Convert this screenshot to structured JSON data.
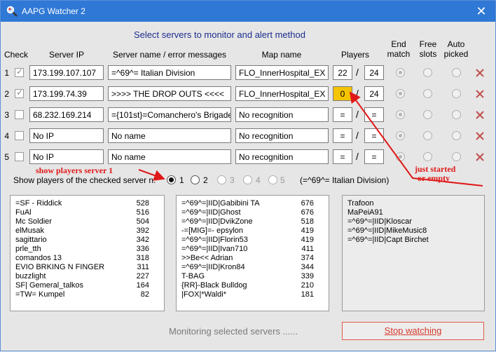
{
  "window": {
    "title": "AAPG Watcher 2",
    "close_glyph": "✕"
  },
  "heading": "Select servers to monitor and alert method",
  "columns": {
    "check": "Check",
    "server_ip": "Server IP",
    "server_name": "Server name / error messages",
    "map_name": "Map name",
    "players": "Players",
    "end_match": "End match",
    "free_slots": "Free slots",
    "auto_picked": "Auto picked"
  },
  "servers": [
    {
      "num": "1",
      "checked": true,
      "ip": "173.199.107.107",
      "name": "=^69^= Italian Division",
      "map": "FLO_InnerHospital_EX",
      "players": "22",
      "max": "24"
    },
    {
      "num": "2",
      "checked": true,
      "ip": "173.199.74.39",
      "name": ">>>> THE DROP OUTS <<<<",
      "map": "FLO_InnerHospital_EX",
      "players": "0",
      "max": "24"
    },
    {
      "num": "3",
      "checked": false,
      "ip": "68.232.169.214",
      "name": "={101st}=Comanchero's Brigade",
      "map": "No recognition",
      "players": "=",
      "max": "="
    },
    {
      "num": "4",
      "checked": false,
      "ip": "No IP",
      "name": "No name",
      "map": "No recognition",
      "players": "=",
      "max": "="
    },
    {
      "num": "5",
      "checked": false,
      "ip": "No IP",
      "name": "No name",
      "map": "No recognition",
      "players": "=",
      "max": "="
    }
  ],
  "show_players": {
    "label": "Show players of the checked server n.",
    "options": [
      "1",
      "2",
      "3",
      "4",
      "5"
    ],
    "selected": "1",
    "selected_name": "(=^69^= Italian Division)"
  },
  "player_lists": {
    "left": [
      {
        "name": "=SF - Riddick",
        "score": "528"
      },
      {
        "name": "FuAl",
        "score": "516"
      },
      {
        "name": "Mc Soldier",
        "score": "504"
      },
      {
        "name": "elMusak",
        "score": "392"
      },
      {
        "name": "sagittario",
        "score": "342"
      },
      {
        "name": "prle_tth",
        "score": "336"
      },
      {
        "name": "comandos 13",
        "score": "318"
      },
      {
        "name": "EVIO BRKING N FINGER",
        "score": "311"
      },
      {
        "name": "buzzlight",
        "score": "227"
      },
      {
        "name": "SF| Gemeral_talkos",
        "score": "164"
      },
      {
        "name": "=TW= Kumpel",
        "score": "82"
      }
    ],
    "middle": [
      {
        "name": "=^69^=|IID|Gabibini TA",
        "score": "676"
      },
      {
        "name": "=^69^=|IID|Ghost",
        "score": "676"
      },
      {
        "name": "=^69^=|IID|DvikZone",
        "score": "518"
      },
      {
        "name": "-=[MIG]=- epsylon",
        "score": "419"
      },
      {
        "name": "=^69^=|IID|Florin53",
        "score": "419"
      },
      {
        "name": "=^69^=|IID|Ivan710",
        "score": "411"
      },
      {
        "name": ">>Be<< Adrian",
        "score": "374"
      },
      {
        "name": "=^69^=|IID|Kron84",
        "score": "344"
      },
      {
        "name": "T-BAG",
        "score": "339"
      },
      {
        "name": "{RR}-Black Bulldog",
        "score": "210"
      },
      {
        "name": "|FOX|*Waldi*",
        "score": "181"
      }
    ],
    "right": [
      {
        "name": "Trafoon",
        "score": ""
      },
      {
        "name": "MaPeiA91",
        "score": ""
      },
      {
        "name": "=^69^=|IID|Kloscar",
        "score": ""
      },
      {
        "name": "=^69^=|IID|MikeMusic8",
        "score": ""
      },
      {
        "name": "=^69^=|IID|Capt Birchet",
        "score": ""
      }
    ]
  },
  "status": "Monitoring selected servers ......",
  "stop_button": "Stop watching",
  "annotations": {
    "show_players_note": "show players server 1",
    "just_started_note_line1": "just started",
    "just_started_note_line2": "or empty"
  },
  "colors": {
    "titlebar": "#2f78d6",
    "heading": "#1c2d8e",
    "highlight": "#f5c400",
    "annotation": "#e01818",
    "delete_x": "#c0504d"
  },
  "icons": {
    "app": "magnifier-icon",
    "row_delete": "delete-x-icon",
    "window_close": "close-icon"
  }
}
